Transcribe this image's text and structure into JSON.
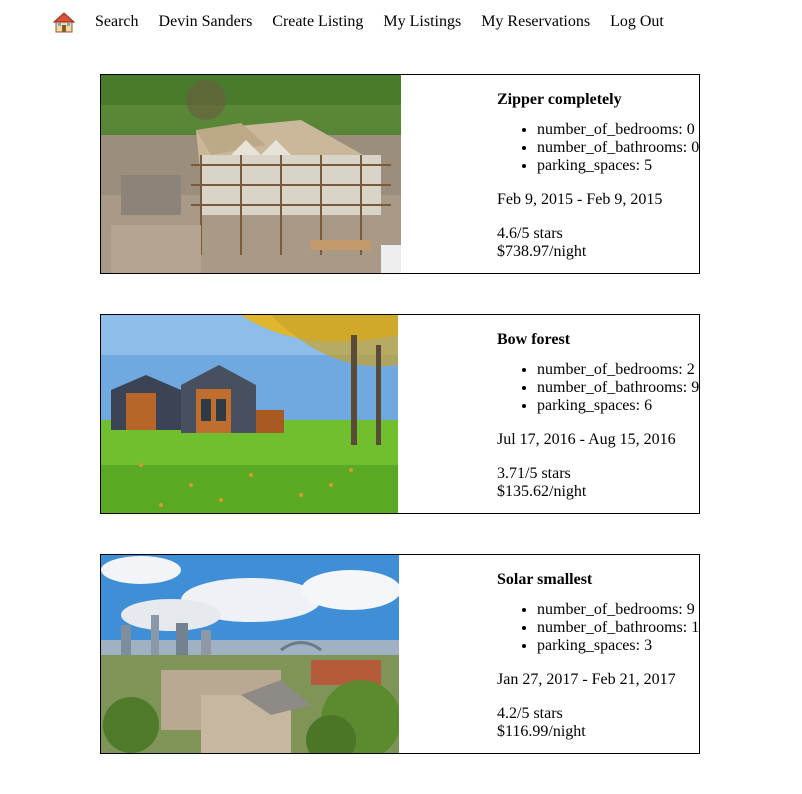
{
  "nav": {
    "home_icon": "house-icon",
    "links": [
      "Search",
      "Devin Sanders",
      "Create Listing",
      "My Listings",
      "My Reservations",
      "Log Out"
    ]
  },
  "listings": [
    {
      "title": "Zipper completely",
      "bedrooms": "number_of_bedrooms: 0",
      "bathrooms": "number_of_bathrooms: 0",
      "parking": "parking_spaces: 5",
      "dates": "Feb 9, 2015 - Feb 9, 2015",
      "rating": "4.6/5 stars",
      "price": "$738.97/night"
    },
    {
      "title": "Bow forest",
      "bedrooms": "number_of_bedrooms: 2",
      "bathrooms": "number_of_bathrooms: 9",
      "parking": "parking_spaces: 6",
      "dates": "Jul 17, 2016 - Aug 15, 2016",
      "rating": "3.71/5 stars",
      "price": "$135.62/night"
    },
    {
      "title": "Solar smallest",
      "bedrooms": "number_of_bedrooms: 9",
      "bathrooms": "number_of_bathrooms: 1",
      "parking": "parking_spaces: 3",
      "dates": "Jan 27, 2017 - Feb 21, 2017",
      "rating": "4.2/5 stars",
      "price": "$116.99/night"
    }
  ]
}
